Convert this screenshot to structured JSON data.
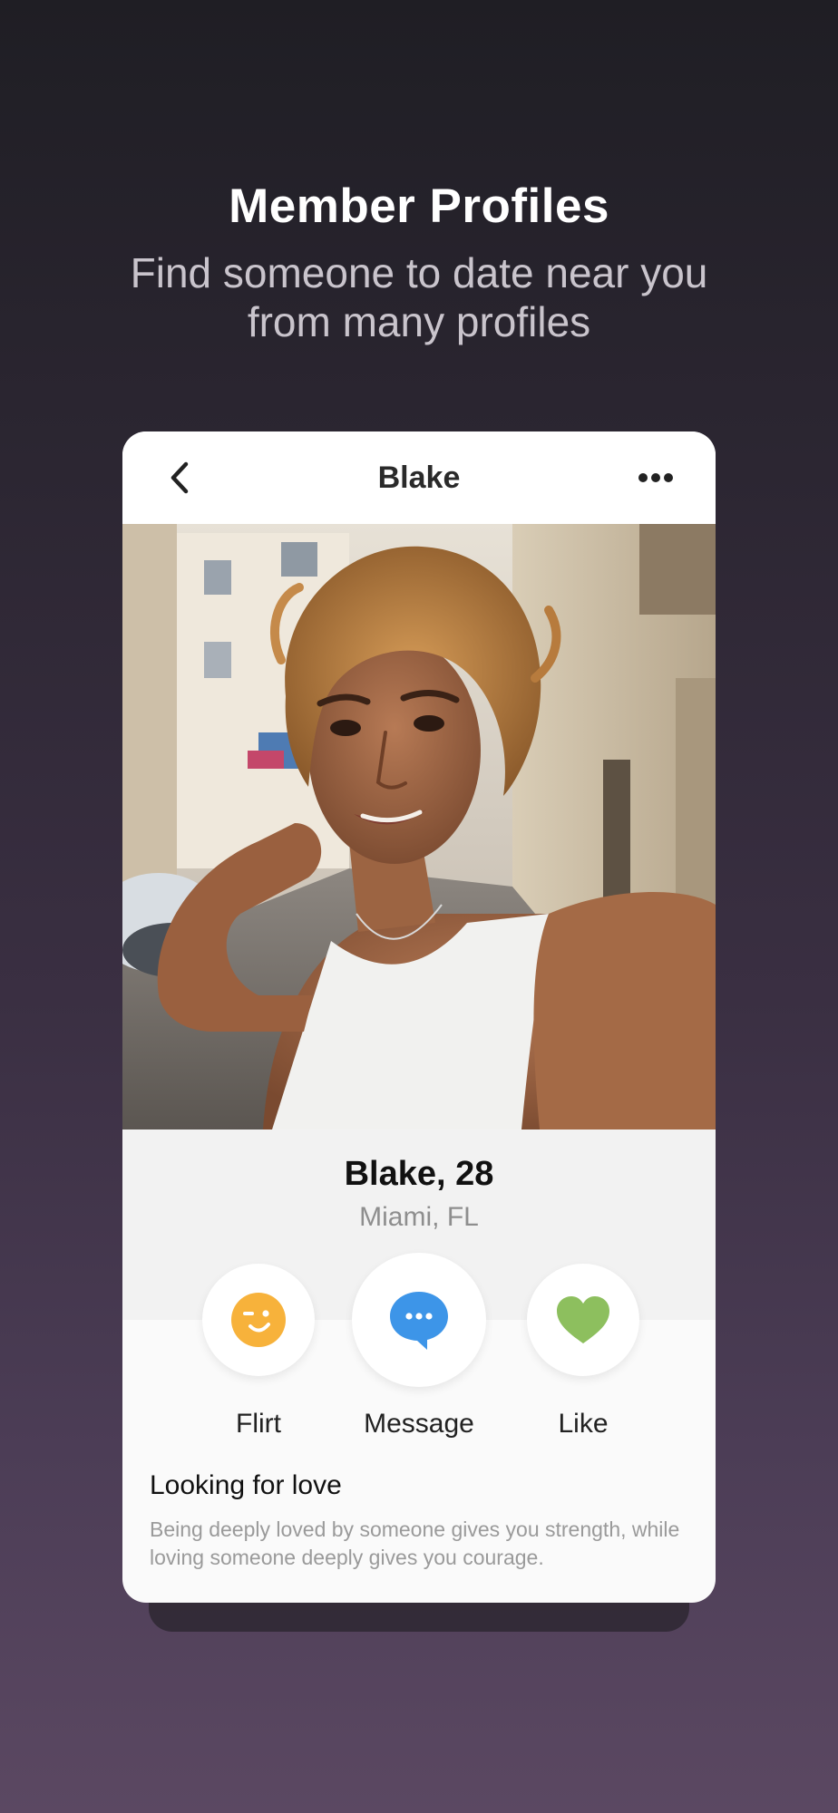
{
  "hero": {
    "title": "Member Profiles",
    "subtitle": "Find someone to date near you from many profiles"
  },
  "card": {
    "header_title": "Blake",
    "back_icon": "chevron-left-icon",
    "more_icon": "more-horizontal-icon",
    "photo_alt": "profile-photo",
    "profile_name": "Blake, 28",
    "profile_location": "Miami, FL",
    "actions": [
      {
        "label": "Flirt",
        "icon": "wink-face-icon",
        "color": "#f7b23b"
      },
      {
        "label": "Message",
        "icon": "chat-bubble-icon",
        "color": "#3d95e8"
      },
      {
        "label": "Like",
        "icon": "heart-icon",
        "color": "#8dbf5e"
      }
    ],
    "section_heading": "Looking for love",
    "section_body": "Being deeply loved by someone gives you strength, while loving someone deeply gives you courage."
  },
  "colors": {
    "background_top": "#1f1e24",
    "background_bottom": "#5b4862",
    "card_bg": "#fafafa",
    "info_band": "#f2f2f2"
  }
}
